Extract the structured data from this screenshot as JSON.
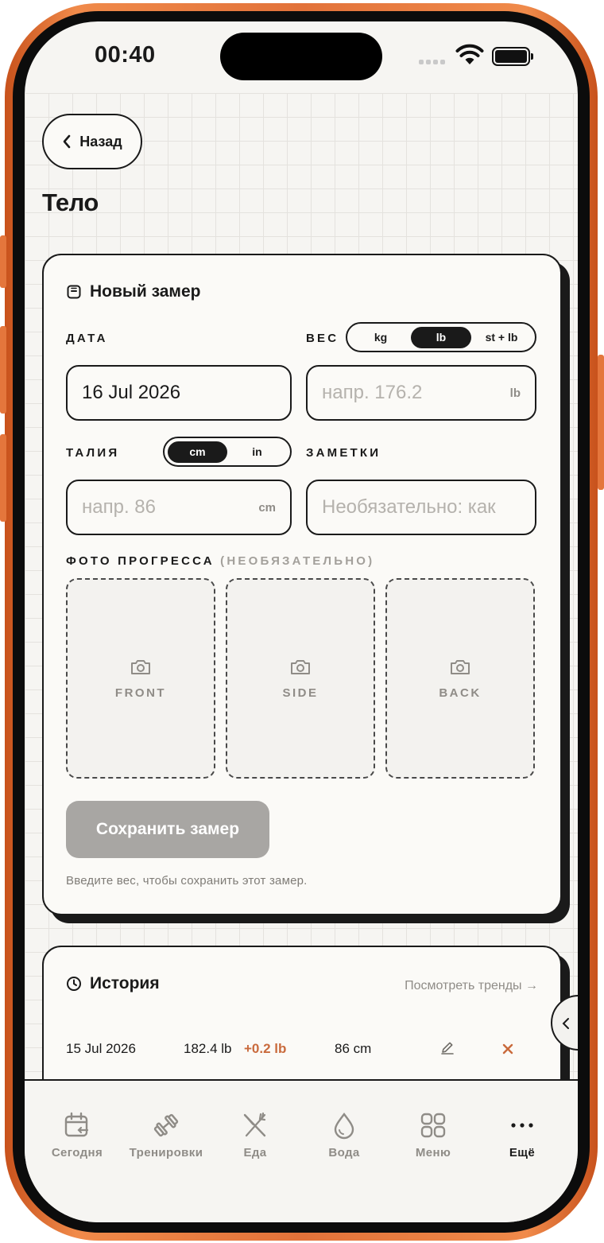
{
  "status": {
    "time": "00:40"
  },
  "header": {
    "back_label": "Назад",
    "title": "Тело"
  },
  "new_measure": {
    "title": "Новый замер",
    "date_label": "ДАТА",
    "date_value": "16 Jul 2026",
    "weight_label": "ВЕС",
    "weight_units": [
      "kg",
      "lb",
      "st + lb"
    ],
    "weight_selected": "lb",
    "weight_placeholder": "напр. 176.2",
    "weight_unit": "lb",
    "waist_label": "ТАЛИЯ",
    "waist_units": [
      "cm",
      "in"
    ],
    "waist_selected": "cm",
    "waist_placeholder": "напр. 86",
    "waist_unit": "cm",
    "notes_label": "ЗАМЕТКИ",
    "notes_placeholder": "Необязательно: как",
    "photos_label": "ФОТО ПРОГРЕССА",
    "photos_optional": "(НЕОБЯЗАТЕЛЬНО)",
    "photos": [
      "FRONT",
      "SIDE",
      "BACK"
    ],
    "save_label": "Сохранить замер",
    "hint": "Введите вес, чтобы сохранить этот замер."
  },
  "history": {
    "title": "История",
    "trends_link": "Посмотреть тренды →",
    "rows": [
      {
        "date": "15 Jul 2026",
        "weight": "182.4 lb",
        "delta": "+0.2 lb",
        "waist": "86 cm"
      }
    ]
  },
  "tabs": [
    {
      "label": "Сегодня",
      "icon": "calendar-icon"
    },
    {
      "label": "Тренировки",
      "icon": "dumbbell-icon"
    },
    {
      "label": "Еда",
      "icon": "fork-knife-icon"
    },
    {
      "label": "Вода",
      "icon": "water-drop-icon"
    },
    {
      "label": "Меню",
      "icon": "grid-icon"
    },
    {
      "label": "Ещё",
      "icon": "more-dots-icon",
      "active": true
    }
  ],
  "colors": {
    "accent": "#c96a3c",
    "ink": "#1a1a1a",
    "frame": "#e2723a",
    "disabled": "#a8a6a3"
  }
}
